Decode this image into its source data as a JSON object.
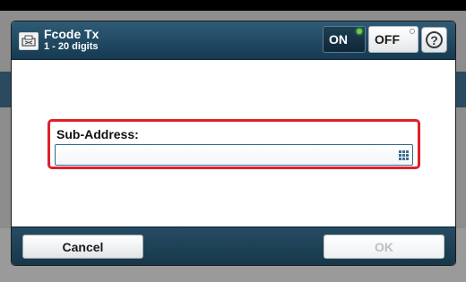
{
  "header": {
    "title": "Fcode Tx",
    "subtitle": "1 - 20 digits",
    "icon": "fax-icon"
  },
  "toggle": {
    "on_label": "ON",
    "off_label": "OFF",
    "on_active": true
  },
  "help": {
    "label": "?",
    "icon": "help-icon"
  },
  "field": {
    "label": "Sub-Address:",
    "value": "",
    "keypad_icon": "keypad-icon"
  },
  "footer": {
    "cancel_label": "Cancel",
    "ok_label": "OK",
    "ok_enabled": false
  },
  "colors": {
    "title_bar": "#1f4a63",
    "focus_frame": "#e0202a",
    "on_indicator": "#5fd63a"
  }
}
